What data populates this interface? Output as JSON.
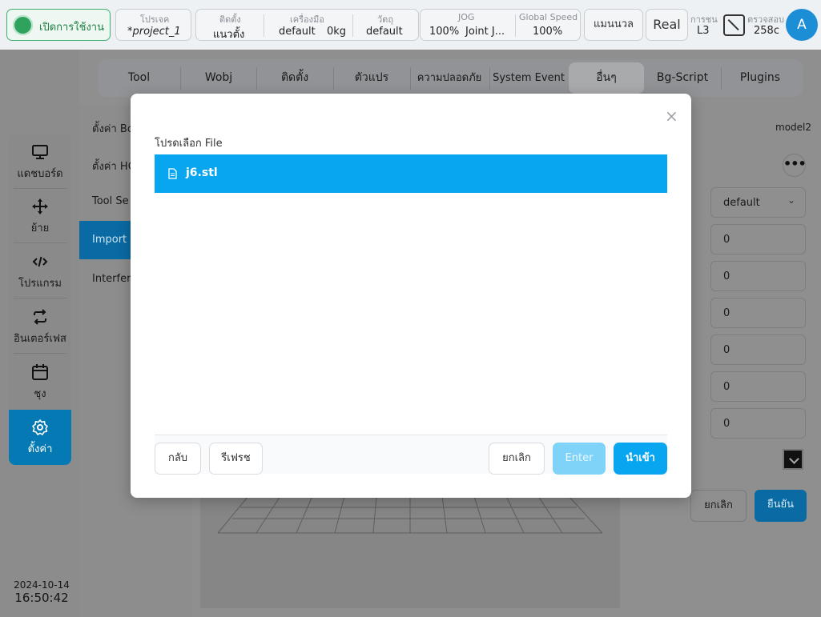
{
  "topbar": {
    "power_label": "เปิดการใช้งาน",
    "project": {
      "label": "โปรเจค",
      "value": "*project_1"
    },
    "install": {
      "label": "ติดตั้ง",
      "value": "แนวตั้ง"
    },
    "tool": {
      "label": "เครื่องมือ",
      "value": "default",
      "payload": "0kg"
    },
    "workobj": {
      "label": "วัตถุ",
      "value": "default"
    },
    "jog": {
      "label": "JOG",
      "value": "100%",
      "mode": "Joint J..."
    },
    "global_speed": {
      "label": "Global Speed",
      "value": "100%"
    },
    "manual_label": "แมนนวล",
    "real_label": "Real",
    "collision": {
      "label": "การชน",
      "value": "L3"
    },
    "inspect": {
      "label": "ตรวจสอบ",
      "value": "258c"
    },
    "avatar_letter": "A"
  },
  "sidebar": {
    "items": [
      {
        "label": "แดชบอร์ด",
        "icon": "monitor-icon"
      },
      {
        "label": "ย้าย",
        "icon": "move-icon"
      },
      {
        "label": "โปรแกรม",
        "icon": "code-icon"
      },
      {
        "label": "อินเตอร์เฟส",
        "icon": "swap-icon"
      },
      {
        "label": "ชุง",
        "icon": "calendar-icon"
      },
      {
        "label": "ตั้งค่า",
        "icon": "gear-icon",
        "active": true
      }
    ],
    "date": "2024-10-14",
    "time": "16:50:42"
  },
  "tabs": [
    {
      "label": "Tool"
    },
    {
      "label": "Wobj"
    },
    {
      "label": "ติดตั้ง"
    },
    {
      "label": "ตัวแปร"
    },
    {
      "label": "ความปลอดภัย"
    },
    {
      "label": "System Event"
    },
    {
      "label": "อื่นๆ",
      "active": true
    },
    {
      "label": "Bg-Script"
    },
    {
      "label": "Plugins"
    }
  ],
  "left_list": {
    "items": [
      "ตั้งค่า Bo",
      "ตั้งค่า HC",
      "Tool Se",
      "Import M",
      "Interfere"
    ]
  },
  "right_panel": {
    "model_name": "model2",
    "more_label": "•••",
    "select_value": "default",
    "fields": [
      "0",
      "0",
      "0",
      "0",
      "0",
      "0"
    ],
    "cancel_label": "ยกเลิก",
    "confirm_label": "ยืนยัน"
  },
  "modal": {
    "title": "โปรดเลือก File",
    "close_label": "×",
    "files": [
      {
        "name": "j6.stl",
        "selected": true
      }
    ],
    "buttons": {
      "back": "กลับ",
      "refresh": "รีเฟรช",
      "cancel": "ยกเลิก",
      "enter": "Enter",
      "import": "นำเข้า"
    }
  },
  "colors": {
    "accent": "#08a5f0",
    "active_nav": "#0479b3",
    "power_green": "#2fa35d"
  }
}
